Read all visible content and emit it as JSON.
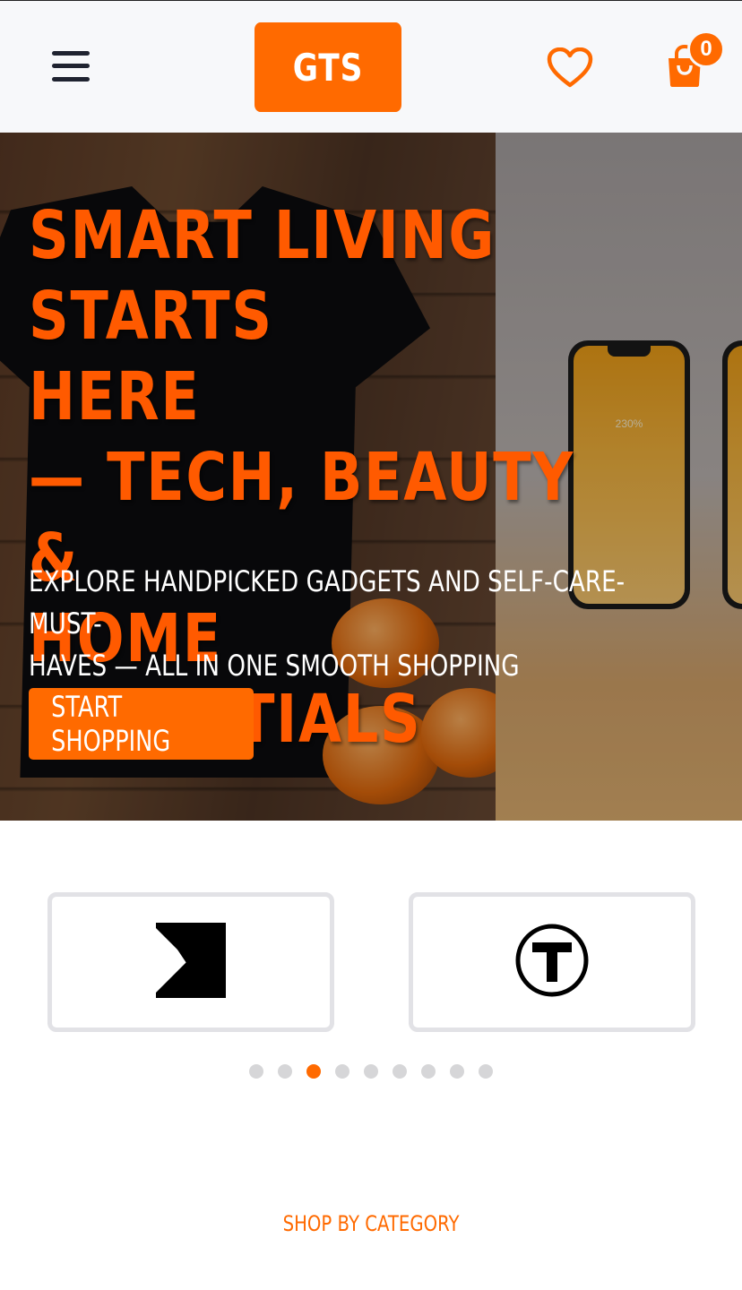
{
  "header": {
    "logo_text": "GTS",
    "menu_icon": "hamburger-menu-icon",
    "wishlist_icon": "heart-icon",
    "cart_icon": "shopping-bag-icon",
    "cart_count": "0",
    "accent_color": "#ff6a00"
  },
  "hero": {
    "title_lines": [
      "SMART LIVING STARTS",
      "HERE",
      "— TECH, BEAUTY &",
      "HOME ESSENTIALS"
    ],
    "subtitle_lines": [
      "EXPLORE HANDPICKED GADGETS AND SELF-CARE-MUST-",
      "HAVES — ALL IN ONE SMOOTH SHOPPING EXPERIENCE."
    ],
    "cta_label": "START SHOPPING",
    "phone_readout": "230%"
  },
  "brands": {
    "items": [
      {
        "icon": "angular-n-logo-icon"
      },
      {
        "icon": "circled-t-logo-icon"
      }
    ],
    "pagination": {
      "total": 9,
      "active_index": 2
    }
  },
  "categories": {
    "label": "SHOP BY CATEGORY"
  }
}
